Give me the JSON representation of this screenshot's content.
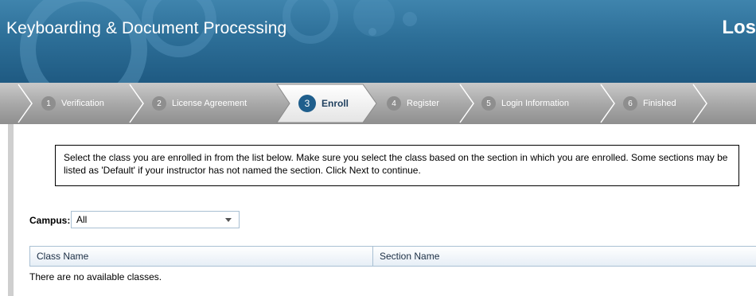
{
  "header": {
    "title": "Keyboarding & Document Processing",
    "brand_text": "Los"
  },
  "steps": [
    {
      "number": "1",
      "label": "Verification"
    },
    {
      "number": "2",
      "label": "License Agreement"
    },
    {
      "number": "3",
      "label": "Enroll"
    },
    {
      "number": "4",
      "label": "Register"
    },
    {
      "number": "5",
      "label": "Login Information"
    },
    {
      "number": "6",
      "label": "Finished"
    }
  ],
  "active_step": 3,
  "instructions": "Select the class you are enrolled in from the list below. Make sure you select the class based on the section in which you are enrolled. Some sections may be listed as 'Default' if your instructor has not named the section. Click Next to continue.",
  "campus": {
    "label": "Campus:",
    "selected": "All"
  },
  "table": {
    "columns": [
      "Class Name",
      "Section Name"
    ],
    "empty_message": "There are no available classes."
  },
  "colors": {
    "header_blue": "#2d6f98",
    "active_step_blue": "#1f5e8c",
    "step_bar_gray": "#a9a9a9"
  }
}
